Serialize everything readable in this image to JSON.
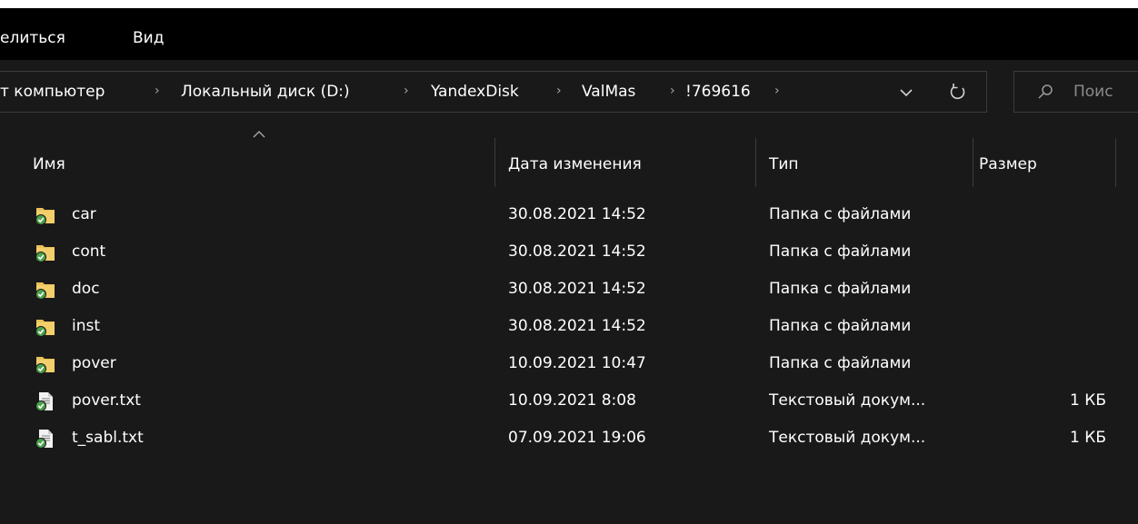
{
  "ribbon": {
    "tabs": [
      "елиться",
      "Вид"
    ]
  },
  "address": {
    "crumbs": [
      "т компьютер",
      "Локальный диск (D:)",
      "YandexDisk",
      "ValMas",
      "!769616"
    ],
    "search_placeholder": "Поис"
  },
  "columns": {
    "name": "Имя",
    "date": "Дата изменения",
    "type": "Тип",
    "size": "Размер"
  },
  "files": [
    {
      "name": "car",
      "date": "30.08.2021 14:52",
      "type": "Папка с файлами",
      "size": "",
      "icon": "folder-synced-icon"
    },
    {
      "name": "cont",
      "date": "30.08.2021 14:52",
      "type": "Папка с файлами",
      "size": "",
      "icon": "folder-synced-icon"
    },
    {
      "name": "doc",
      "date": "30.08.2021 14:52",
      "type": "Папка с файлами",
      "size": "",
      "icon": "folder-synced-icon"
    },
    {
      "name": "inst",
      "date": "30.08.2021 14:52",
      "type": "Папка с файлами",
      "size": "",
      "icon": "folder-synced-icon"
    },
    {
      "name": "pover",
      "date": "10.09.2021 10:47",
      "type": "Папка с файлами",
      "size": "",
      "icon": "folder-synced-icon"
    },
    {
      "name": "pover.txt",
      "date": "10.09.2021 8:08",
      "type": "Текстовый докум...",
      "size": "1 КБ",
      "icon": "text-file-synced-icon"
    },
    {
      "name": "t_sabl.txt",
      "date": "07.09.2021 19:06",
      "type": "Текстовый докум...",
      "size": "1 КБ",
      "icon": "text-file-synced-icon"
    }
  ],
  "colors": {
    "background": "#191919",
    "ribbon": "#000000",
    "border": "#3b3b3b",
    "folder": "#e8c15a",
    "sync_check": "#4ca24c",
    "separator": "#a8a8a8"
  }
}
